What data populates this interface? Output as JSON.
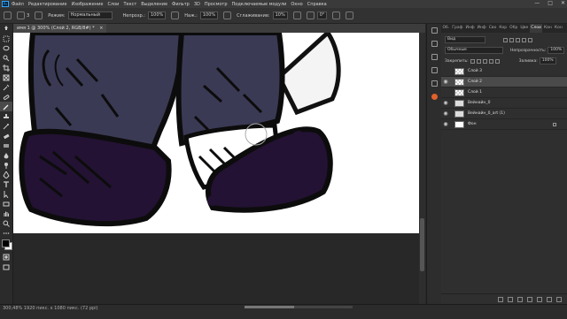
{
  "menu": {
    "logo": "Ps",
    "items": [
      "Файл",
      "Редактирование",
      "Изображение",
      "Слои",
      "Текст",
      "Выделение",
      "Фильтр",
      "3D",
      "Просмотр",
      "Подключаемые модули",
      "Окно",
      "Справка"
    ],
    "window_buttons": [
      "—",
      "□",
      "✕"
    ]
  },
  "options": {
    "brush_size": "3",
    "mode_label": "Режим:",
    "mode_value": "Нормальный",
    "opacity_label": "Непрозр.:",
    "opacity_value": "100%",
    "pressure_label": "Наж.:",
    "pressure_value": "100%",
    "smoothing_label": "Сглаживание:",
    "smoothing_value": "10%",
    "angle_value": "0°"
  },
  "document": {
    "tab_title": "имя 1 @ 300% (Слой 2, RGB/8#) *",
    "tab_close": "×"
  },
  "status": {
    "text": "300,48%   1920 пикс. x 1080 пикс. (72 ppi)"
  },
  "panel": {
    "tabs": [
      "Об.",
      "Граф",
      "Инф",
      "Инф",
      "Сво",
      "Кор",
      "Обр",
      "Цве",
      "Слои",
      "Кан",
      "Кон"
    ],
    "active_tab_index": 8,
    "filter_label": "Вид",
    "blend_mode": "Обычные",
    "opacity_label": "Непрозрачность:",
    "opacity_value": "100%",
    "lock_label": "Закрепить:",
    "fill_label": "Заливка:",
    "fill_value": "100%",
    "layers": [
      {
        "name": "Слой 3",
        "visible": false,
        "selected": false,
        "thumb": "transparent"
      },
      {
        "name": "Слой 2",
        "visible": true,
        "selected": true,
        "thumb": "transparent"
      },
      {
        "name": "Слой 1",
        "visible": false,
        "selected": false,
        "thumb": "transparent"
      },
      {
        "name": "Вейнайн_0",
        "visible": true,
        "selected": false,
        "thumb": "art"
      },
      {
        "name": "Вейнайн_0_art (1)",
        "visible": true,
        "selected": false,
        "thumb": "art"
      },
      {
        "name": "Фон",
        "visible": true,
        "selected": false,
        "thumb": "white",
        "locked": true
      }
    ]
  }
}
